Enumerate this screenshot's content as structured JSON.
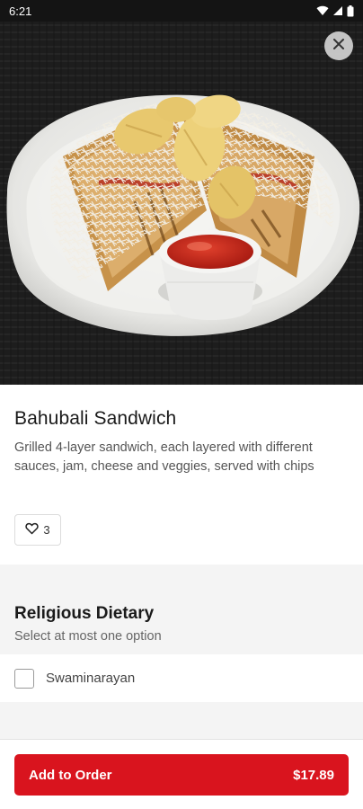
{
  "status_bar": {
    "time": "6:21"
  },
  "item": {
    "title": "Bahubali Sandwich",
    "description": "Grilled 4-layer sandwich, each layered with different sauces, jam, cheese and veggies, served with chips",
    "likes": "3"
  },
  "modifier_group": {
    "title": "Religious Dietary",
    "subtitle": "Select at most one option",
    "options": [
      {
        "label": "Swaminarayan",
        "checked": false
      }
    ]
  },
  "cart_button": {
    "label": "Add to Order",
    "price": "$17.89"
  },
  "colors": {
    "accent": "#d9141e",
    "status_bar": "#141414",
    "band": "#f4f4f4"
  },
  "icons": [
    "wifi-icon",
    "signal-icon",
    "battery-icon",
    "close-icon",
    "heart-icon",
    "checkbox-icon"
  ]
}
